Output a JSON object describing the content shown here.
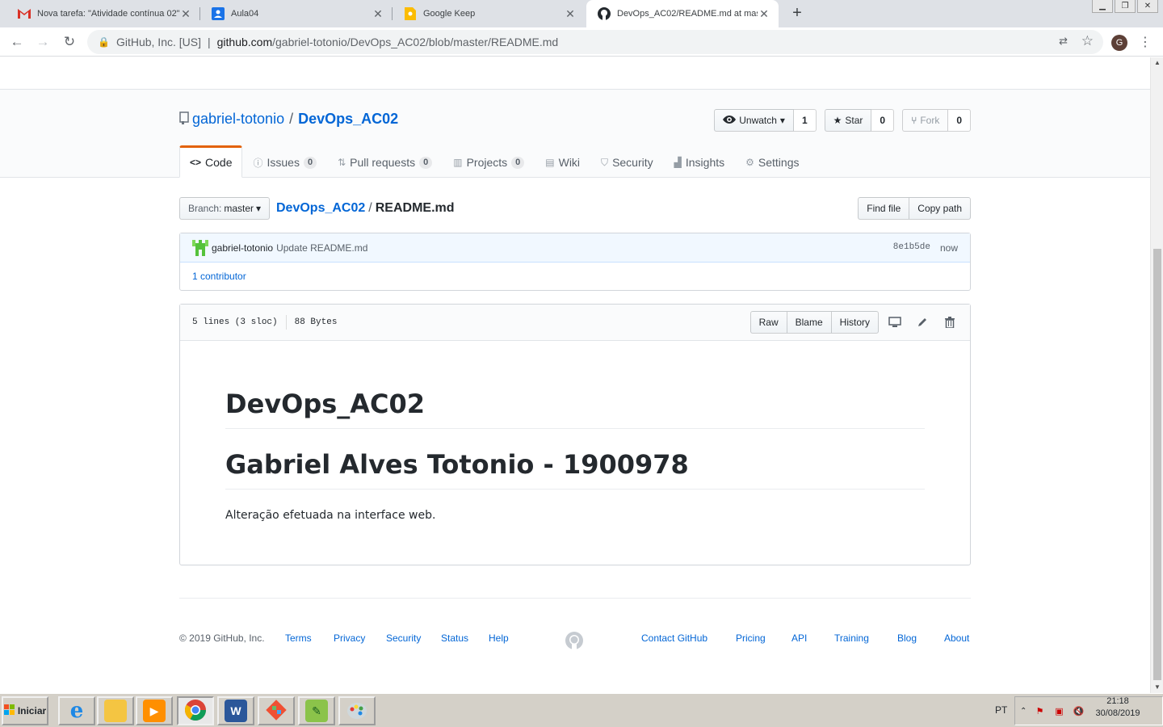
{
  "browser": {
    "tabs": [
      {
        "title": "Nova tarefa: \"Atividade contínua 02\"",
        "icon": "gmail-icon",
        "active": false
      },
      {
        "title": "Aula04",
        "icon": "classroom-icon",
        "active": false
      },
      {
        "title": "Google Keep",
        "icon": "keep-icon",
        "active": false
      },
      {
        "title": "DevOps_AC02/README.md at master",
        "icon": "github-icon",
        "active": true
      }
    ],
    "new_tab": "+",
    "site_identity": "GitHub, Inc. [US]",
    "url_host": "github.com",
    "url_path": "/gabriel-totonio/DevOps_AC02/blob/master/README.md",
    "profile_initial": "G"
  },
  "repo": {
    "owner": "gabriel-totonio",
    "name": "DevOps_AC02",
    "watch_label": "Unwatch",
    "watch_count": "1",
    "star_label": "Star",
    "star_count": "0",
    "fork_label": "Fork",
    "fork_count": "0",
    "tabs": [
      {
        "label": "Code",
        "icon": "code-icon",
        "selected": true
      },
      {
        "label": "Issues",
        "icon": "issue-icon",
        "count": "0"
      },
      {
        "label": "Pull requests",
        "icon": "pull-request-icon",
        "count": "0"
      },
      {
        "label": "Projects",
        "icon": "project-icon",
        "count": "0"
      },
      {
        "label": "Wiki",
        "icon": "book-icon"
      },
      {
        "label": "Security",
        "icon": "shield-icon"
      },
      {
        "label": "Insights",
        "icon": "graph-icon"
      },
      {
        "label": "Settings",
        "icon": "gear-icon"
      }
    ]
  },
  "file_nav": {
    "branch_prefix": "Branch:",
    "branch": "master",
    "crumb_repo": "DevOps_AC02",
    "crumb_sep": "/",
    "crumb_file": "README.md",
    "find_file": "Find file",
    "copy_path": "Copy path"
  },
  "commit": {
    "author": "gabriel-totonio",
    "message": "Update README.md",
    "sha": "8e1b5de",
    "time": "now",
    "contributors": "1 contributor"
  },
  "file": {
    "lines": "5 lines (3 sloc)",
    "size": "88 Bytes",
    "raw": "Raw",
    "blame": "Blame",
    "history": "History",
    "h1a": "DevOps_AC02",
    "h1b": "Gabriel Alves Totonio - 1900978",
    "paragraph": "Alteração efetuada na interface web."
  },
  "footer": {
    "copyright": "© 2019 GitHub, Inc.",
    "left_links": [
      "Terms",
      "Privacy",
      "Security",
      "Status",
      "Help"
    ],
    "right_links": [
      "Contact GitHub",
      "Pricing",
      "API",
      "Training",
      "Blog",
      "About"
    ]
  },
  "taskbar": {
    "start": "Iniciar",
    "apps": [
      "internet-explorer",
      "file-explorer",
      "media-player",
      "chrome",
      "word",
      "git",
      "notepad-plus-plus",
      "paint"
    ],
    "lang": "PT",
    "time": "21:18",
    "date": "30/08/2019"
  },
  "colors": {
    "link": "#0366d6",
    "selected_tab_accent": "#e36209",
    "commit_bg": "#f1f8ff"
  }
}
